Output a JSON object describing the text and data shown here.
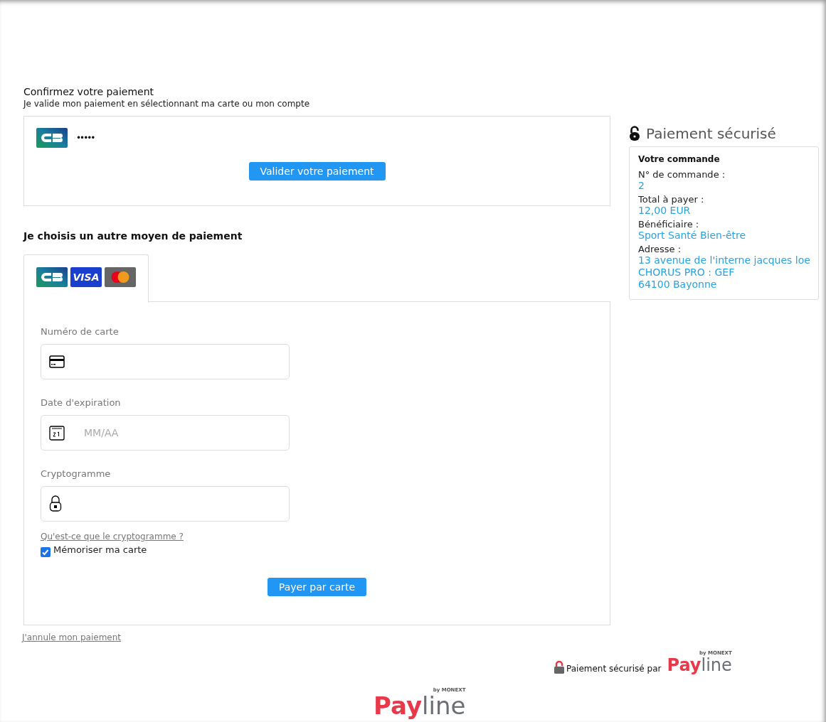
{
  "header": {
    "title": "Confirmez votre paiement",
    "subtitle": "Je valide mon paiement en sélectionnant ma carte ou mon compte"
  },
  "saved_card": {
    "masked_number": "•••••",
    "button": "Valider votre paiement"
  },
  "other_method": {
    "title": "Je choisis un autre moyen de paiement",
    "tabs": [
      {
        "kind": "cards",
        "brand_text": "VISA",
        "selected": true
      }
    ],
    "fields": [
      {
        "kind": "card_number",
        "label": "Numéro de carte"
      },
      {
        "kind": "expiry",
        "label": "Date d'expiration",
        "placeholder": "MM/AA"
      },
      {
        "kind": "cvv",
        "label": "Cryptogramme"
      }
    ],
    "help_link": "Qu'est-ce que le cryptogramme ?",
    "remember": {
      "label": "Mémoriser ma carte",
      "checked": true
    },
    "pay_button": "Payer par carte"
  },
  "cancel_link": "J'annule mon paiement",
  "sidebar": {
    "title": "Paiement sécurisé",
    "order_title": "Votre commande",
    "rows": [
      {
        "label": "N° de commande :",
        "values": [
          "2"
        ]
      },
      {
        "label": "Total à payer :",
        "values": [
          "12,00 EUR"
        ]
      },
      {
        "label": "Bénéficiaire :",
        "values": [
          "Sport Santé Bien-être"
        ]
      },
      {
        "label": "Adresse :",
        "values": [
          "13 avenue de l'interne jacques loe",
          "CHORUS PRO : GEF",
          "64100 Bayonne"
        ]
      }
    ]
  },
  "secured_by": {
    "text": "Paiement sécurisé par",
    "logo_first": "Pay",
    "logo_second": "line",
    "logo_tagline": "by MONEXT"
  },
  "bottom_logo": {
    "logo_first": "Pay",
    "logo_second": "line",
    "logo_tagline": "by MONEXT"
  }
}
